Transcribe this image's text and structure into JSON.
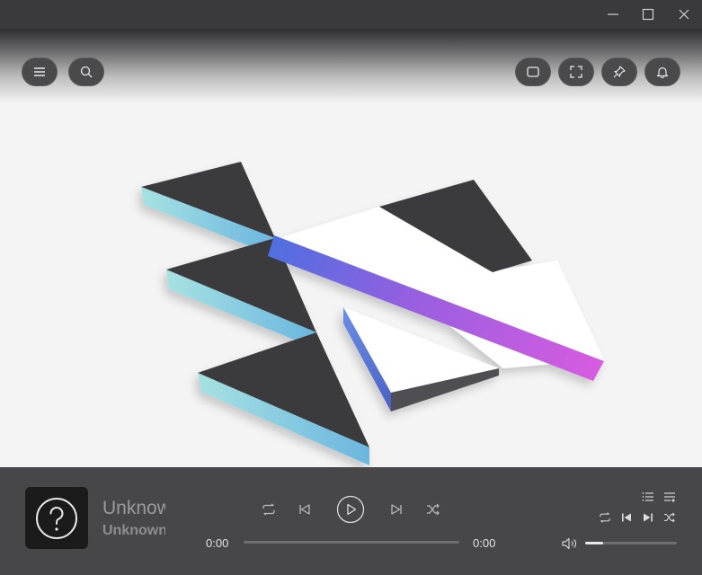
{
  "window": {
    "controls": [
      "minimize-icon",
      "maximize-icon",
      "close-icon"
    ]
  },
  "toolbar": {
    "left": [
      "menu-icon",
      "search-icon"
    ],
    "right": [
      "mini-mode-icon",
      "fullscreen-icon",
      "pin-icon",
      "notification-icon"
    ]
  },
  "track": {
    "title": "Unknown",
    "artist": "Unknown",
    "cover_icon": "question-mark-icon",
    "elapsed": "0:00",
    "duration": "0:00",
    "progress_fraction": 0
  },
  "controls": [
    "repeat-icon",
    "previous-icon",
    "play-icon",
    "next-icon",
    "shuffle-icon"
  ],
  "side_controls": [
    "playlist-icon",
    "queue-icon",
    "repeat-icon",
    "previous-icon",
    "next-icon",
    "shuffle-icon",
    "volume-icon"
  ],
  "volume": {
    "level_fraction": 0.2
  },
  "colors": {
    "titlebar": "#3a3a3c",
    "player_bar": "#47474a",
    "stripe_start": "#4f6fe0",
    "stripe_end": "#d85ce0",
    "teal_edge": "#8fd6d8"
  }
}
